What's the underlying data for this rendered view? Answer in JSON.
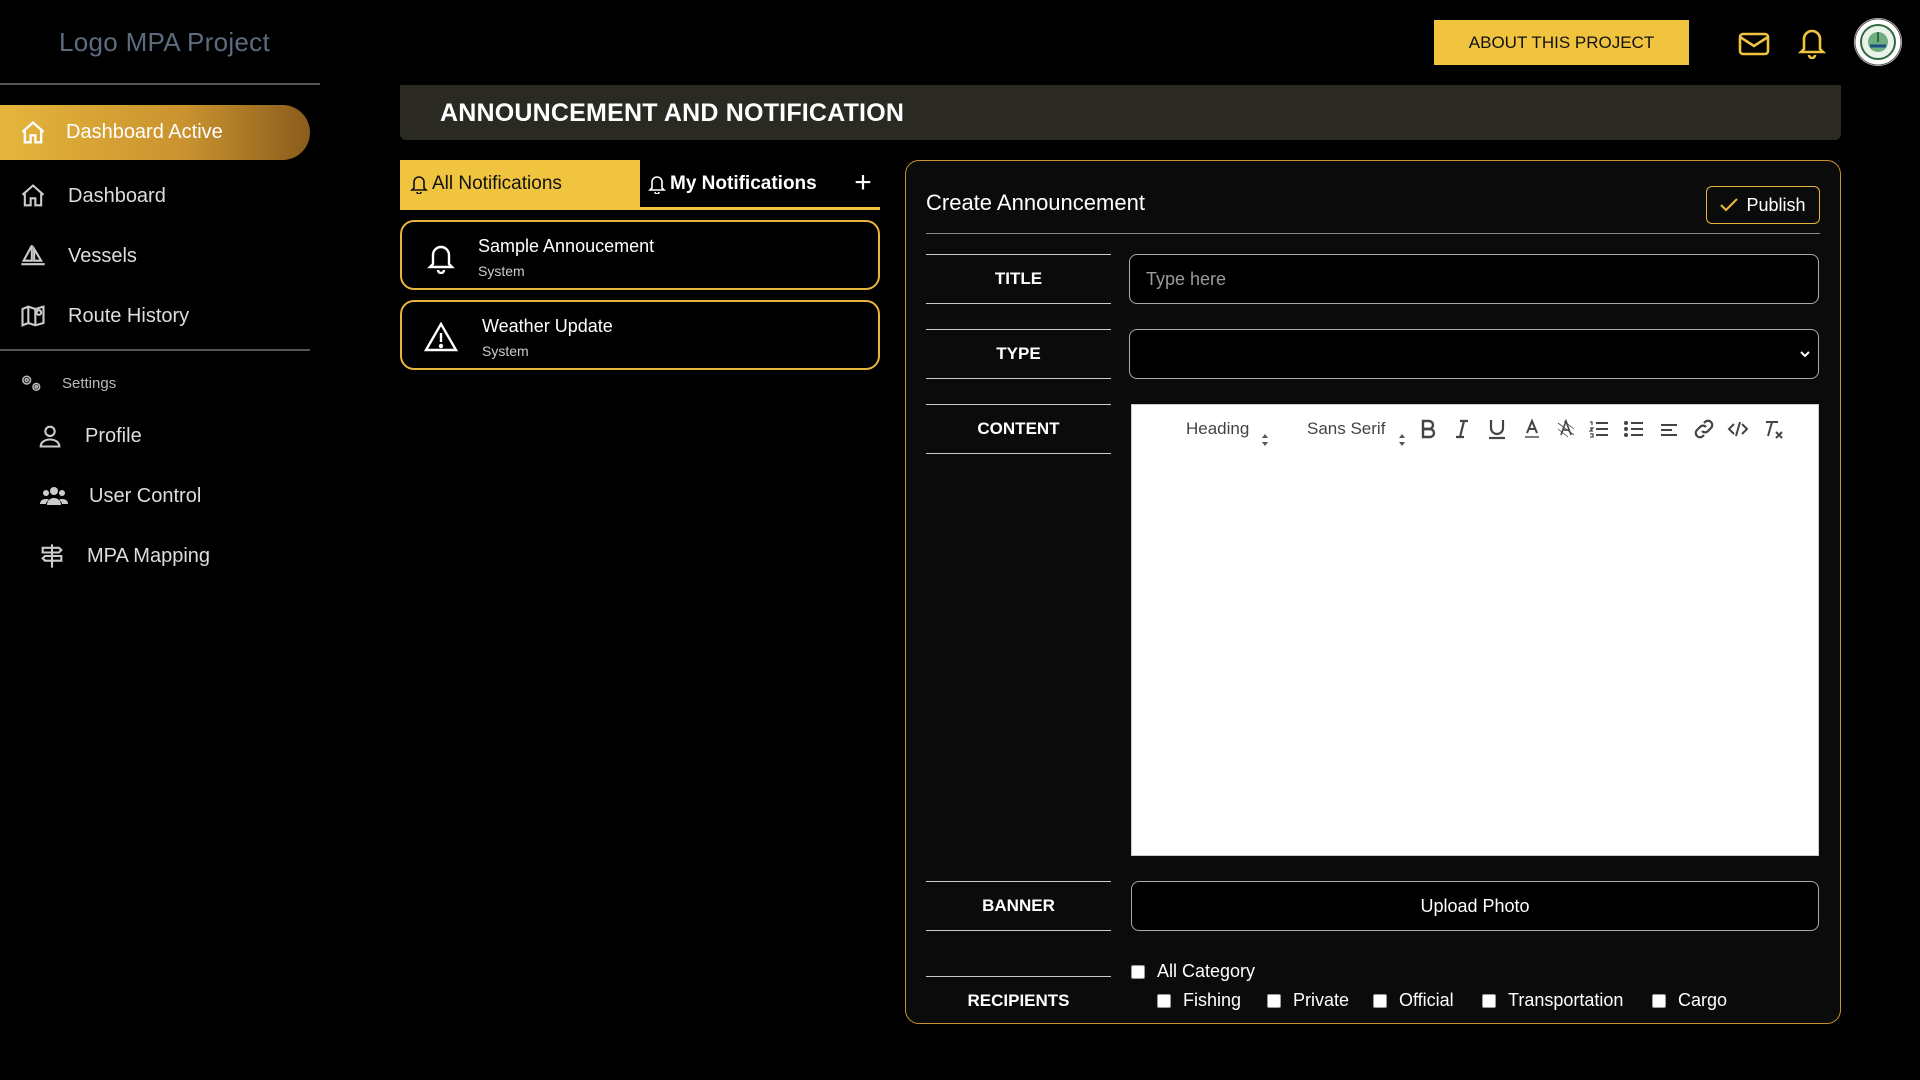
{
  "sidebar": {
    "logo": "Logo MPA Project",
    "active_item": "Dashboard Active",
    "items": [
      {
        "label": "Dashboard"
      },
      {
        "label": "Vessels"
      },
      {
        "label": "Route History"
      }
    ],
    "settings_header": "Settings",
    "settings_items": [
      {
        "label": "Profile"
      },
      {
        "label": "User Control"
      },
      {
        "label": "MPA Mapping"
      }
    ]
  },
  "topbar": {
    "about_label": "ABOUT THIS PROJECT",
    "icons": [
      "mail-icon",
      "bell-icon",
      "avatar-seal"
    ]
  },
  "page": {
    "title": "ANNOUNCEMENT AND NOTIFICATION"
  },
  "tabs": {
    "all_label": "All Notifications",
    "my_label": "My Notifications",
    "add_label": "+"
  },
  "notifications": [
    {
      "title": "Sample Annoucement",
      "source": "System",
      "icon": "bell-icon"
    },
    {
      "title": "Weather Update",
      "source": "System",
      "icon": "warning-icon"
    }
  ],
  "create": {
    "title": "Create Announcement",
    "publish_label": "Publish",
    "fields": {
      "title_label": "TITLE",
      "title_placeholder": "Type here",
      "type_label": "TYPE",
      "content_label": "CONTENT",
      "banner_label": "BANNER",
      "recipients_label": "RECIPIENTS"
    },
    "editor": {
      "heading": "Heading",
      "font": "Sans Serif"
    },
    "upload_label": "Upload Photo",
    "recipients": {
      "all": "All Category",
      "options": [
        "Fishing",
        "Private",
        "Official",
        "Transportation",
        "Cargo"
      ]
    }
  },
  "colors": {
    "accent": "#f0c43f",
    "accent_dark": "#c9922f",
    "header_bg": "#2a2a23"
  }
}
